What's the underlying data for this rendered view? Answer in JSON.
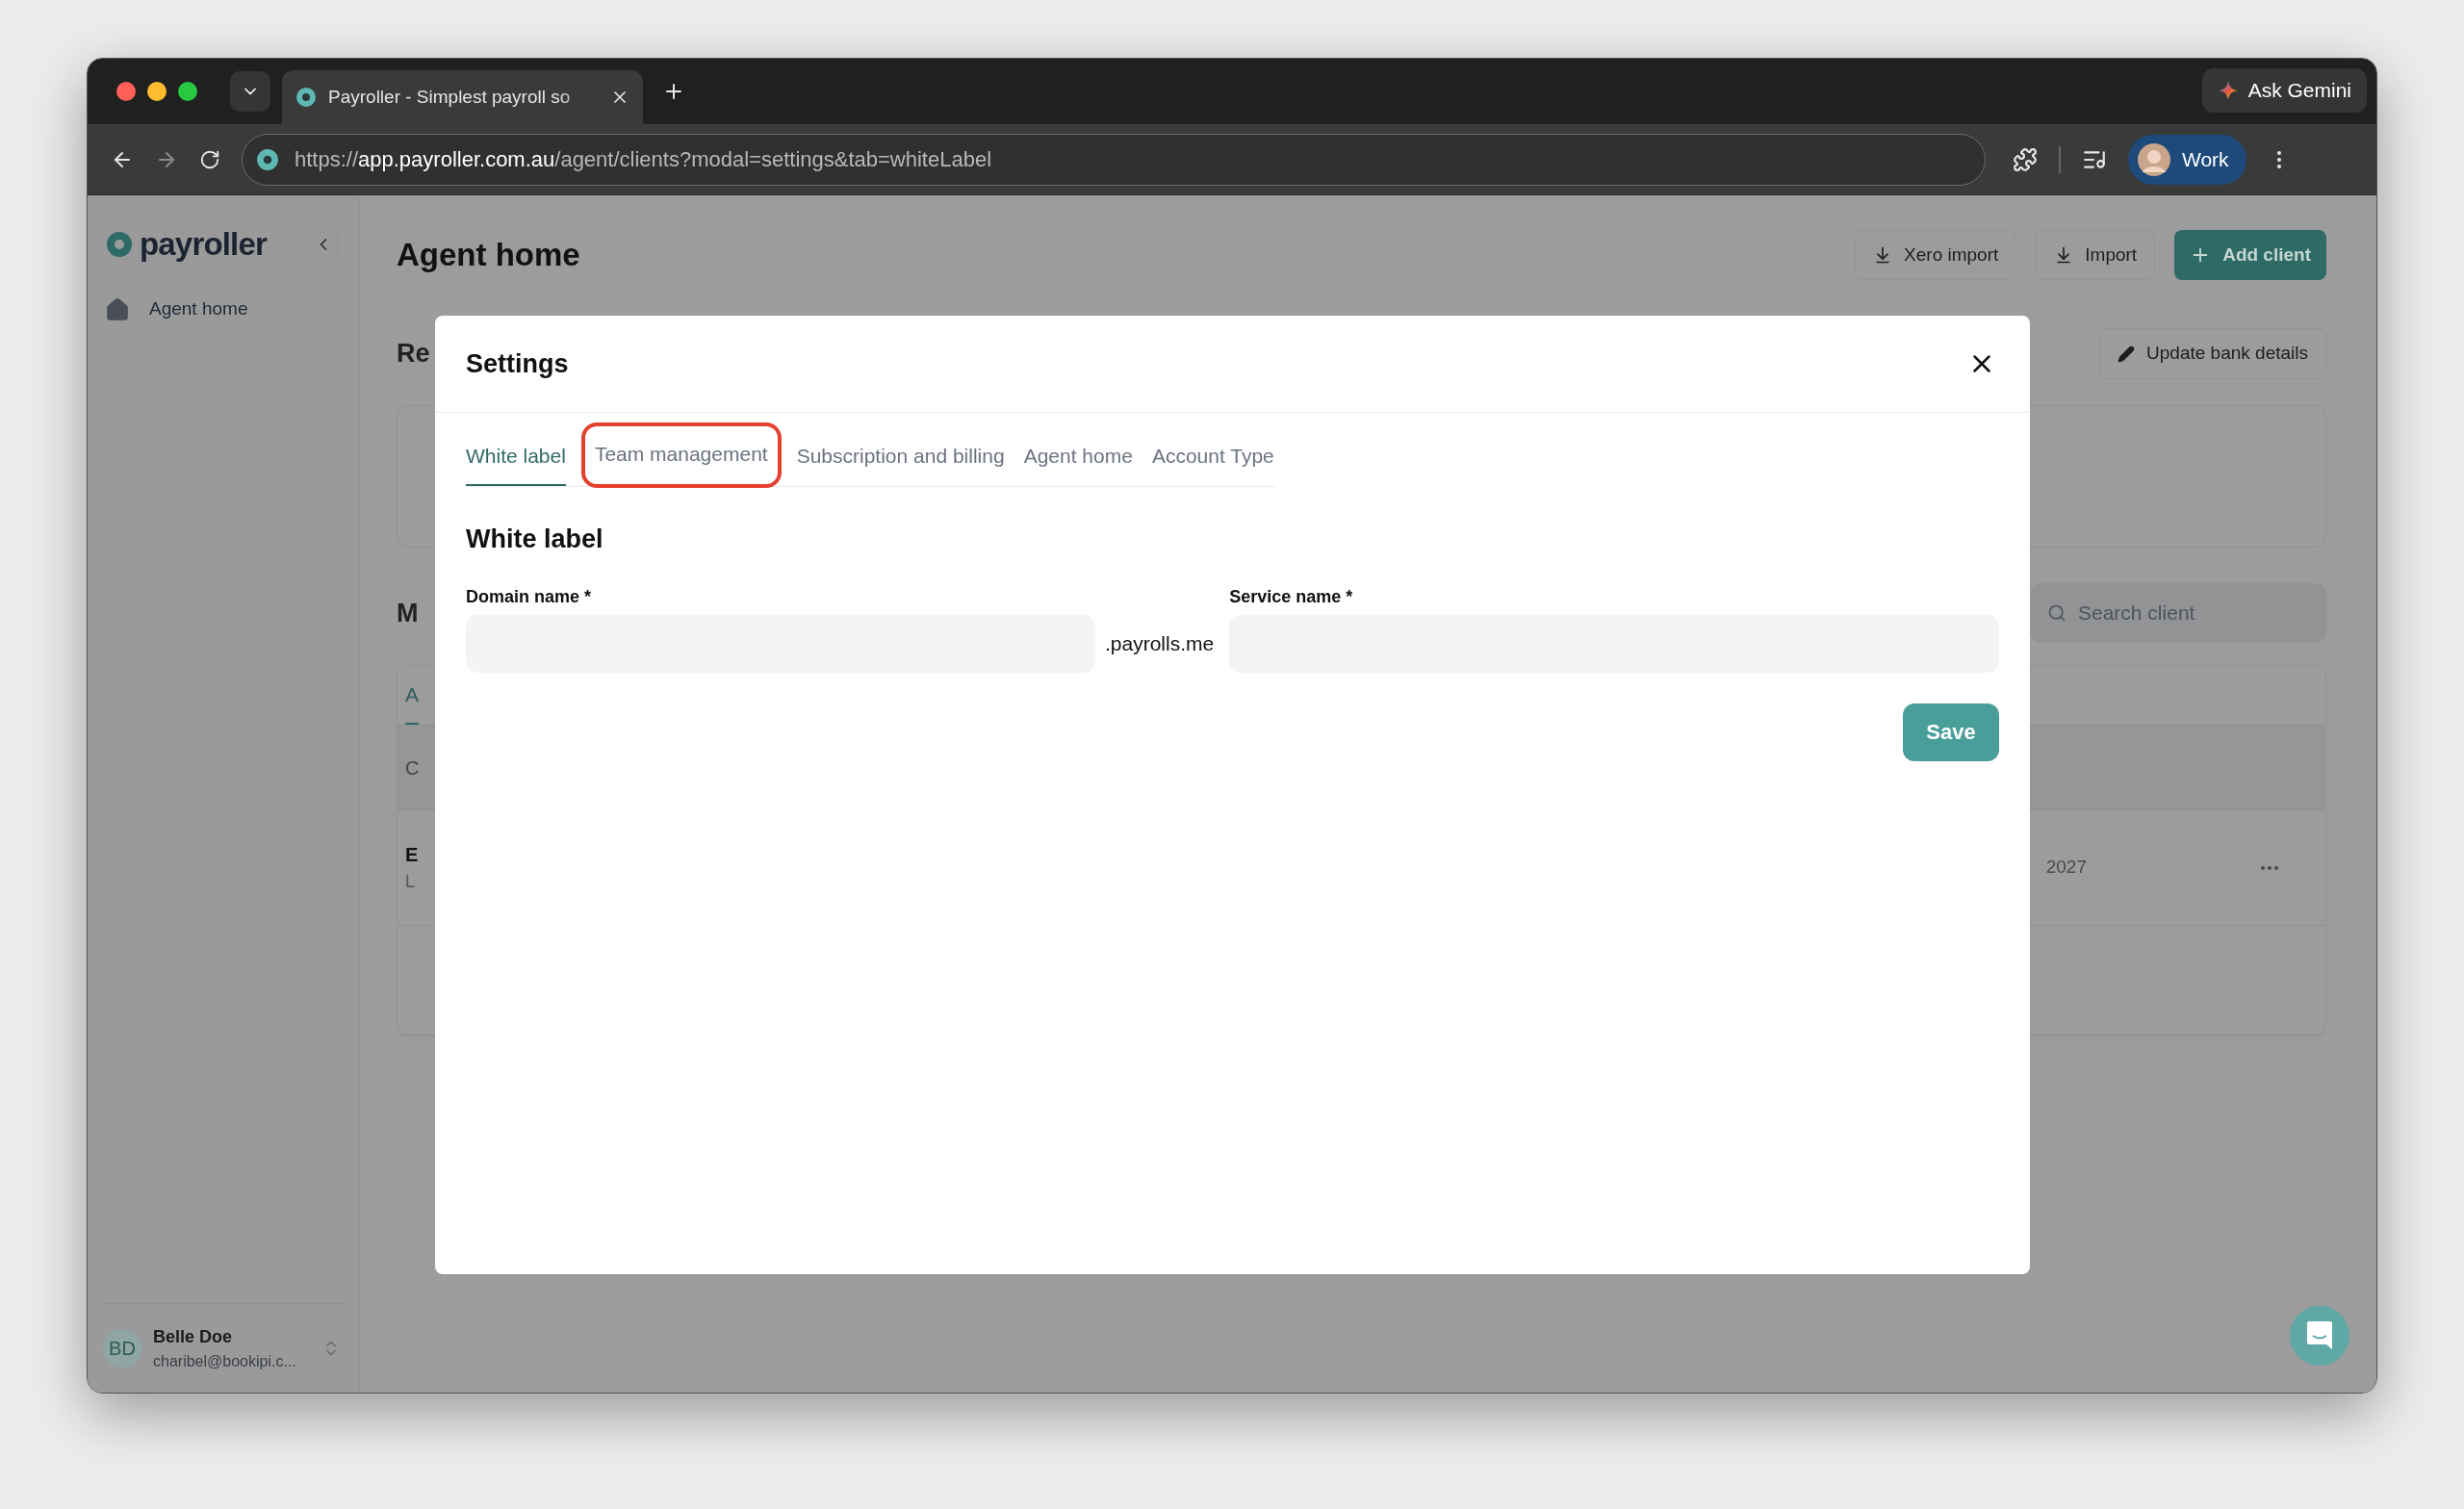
{
  "browser": {
    "tab_title": "Payroller - Simplest payroll so",
    "ask_button": "Ask Gemini",
    "url_scheme": "https://",
    "url_host": "app.payroller.com.au",
    "url_path": "/agent/clients?modal=settings&tab=whiteLabel",
    "profile": "Work"
  },
  "sidebar": {
    "logo": "payroller",
    "items": [
      {
        "label": "Agent home"
      }
    ],
    "user": {
      "initials": "BD",
      "name": "Belle Doe",
      "email": "charibel@bookipi.c..."
    }
  },
  "page": {
    "title": "Agent home",
    "actions": [
      {
        "label": "Xero import",
        "kind": "import"
      },
      {
        "label": "Import",
        "kind": "import"
      },
      {
        "label": "Add client",
        "kind": "primary"
      }
    ],
    "update_button": "Update bank details",
    "section_1": "Re",
    "section_2": "M",
    "search": {
      "placeholder": "Search client"
    },
    "table": {
      "tab": "A",
      "rows": [
        {
          "col_1": "C"
        },
        {
          "col_1": "E",
          "col_1_sub": "L",
          "col_2": "2027"
        },
        {}
      ]
    }
  },
  "modal": {
    "title": "Settings",
    "tabs": [
      {
        "label": "White label",
        "selected": true,
        "highlighted": false
      },
      {
        "label": "Team management",
        "selected": false,
        "highlighted": true
      },
      {
        "label": "Subscription and billing",
        "selected": false,
        "highlighted": false
      },
      {
        "label": "Agent home",
        "selected": false,
        "highlighted": false
      },
      {
        "label": "Account Type",
        "selected": false,
        "highlighted": false
      }
    ],
    "section_title": "White label",
    "fields": [
      {
        "label": "Domain name *",
        "suffix": ".payrolls.me"
      },
      {
        "label": "Service name *"
      }
    ],
    "save": "Save"
  }
}
